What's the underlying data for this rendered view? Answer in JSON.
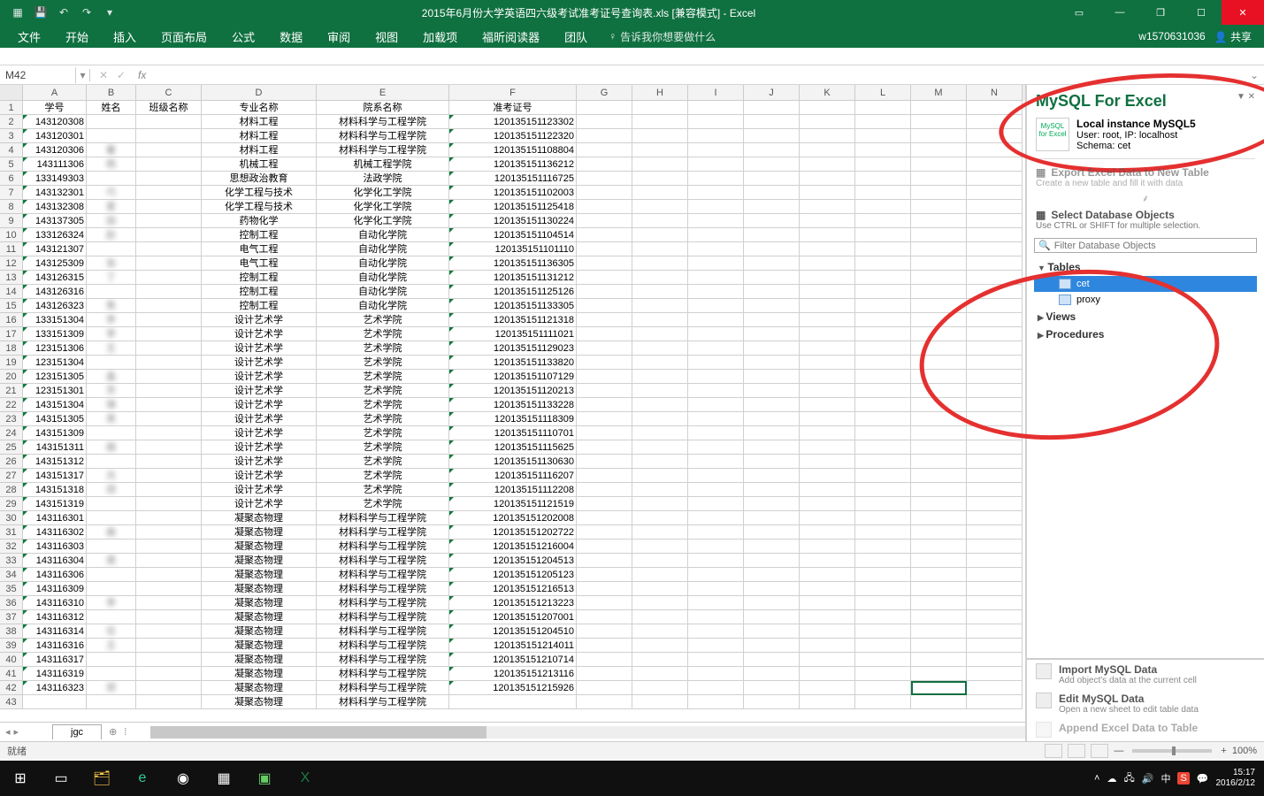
{
  "title": "2015年6月份大学英语四六级考试准考证号查询表.xls [兼容模式] - Excel",
  "qat": {
    "save": "💾",
    "undo": "↶",
    "redo": "↷",
    "more": "▾"
  },
  "ribbon": {
    "tabs": [
      "文件",
      "开始",
      "插入",
      "页面布局",
      "公式",
      "数据",
      "审阅",
      "视图",
      "加载项",
      "福昕阅读器",
      "团队"
    ],
    "tell": "告诉我你想要做什么",
    "user": "w1570631036",
    "share": "共享"
  },
  "namebox": "M42",
  "columns": [
    "A",
    "B",
    "C",
    "D",
    "E",
    "F",
    "G",
    "H",
    "I",
    "J",
    "K",
    "L",
    "M",
    "N"
  ],
  "headers": {
    "A": "学号",
    "B": "姓名",
    "C": "班级名称",
    "D": "专业名称",
    "E": "院系名称",
    "F": "准考证号"
  },
  "rows": [
    {
      "n": 1,
      "A": "学号",
      "B": "姓名",
      "C": "班级名称",
      "D": "专业名称",
      "E": "院系名称",
      "F": "准考证号",
      "hdr": true
    },
    {
      "n": 2,
      "A": "143120308",
      "B": " ",
      "D": "材料工程",
      "E": "材料科学与工程学院",
      "F": "120135151123302"
    },
    {
      "n": 3,
      "A": "143120301",
      "B": " ",
      "D": "材料工程",
      "E": "材料科学与工程学院",
      "F": "120135151122320"
    },
    {
      "n": 4,
      "A": "143120306",
      "B": "暑",
      "D": "材料工程",
      "E": "材料科学与工程学院",
      "F": "120135151108804"
    },
    {
      "n": 5,
      "A": "143111306",
      "B": "杨",
      "D": "机械工程",
      "E": "机械工程学院",
      "F": "120135151136212"
    },
    {
      "n": 6,
      "A": "133149303",
      "B": " ",
      "D": "思想政治教育",
      "E": "法政学院",
      "F": "120135151116725"
    },
    {
      "n": 7,
      "A": "143132301",
      "B": "巧",
      "D": "化学工程与技术",
      "E": "化学化工学院",
      "F": "120135151102003"
    },
    {
      "n": 8,
      "A": "143132308",
      "B": "夏",
      "D": "化学工程与技术",
      "E": "化学化工学院",
      "F": "120135151125418"
    },
    {
      "n": 9,
      "A": "143137305",
      "B": "田",
      "D": "药物化学",
      "E": "化学化工学院",
      "F": "120135151130224"
    },
    {
      "n": 10,
      "A": "133126324",
      "B": "赵",
      "D": "控制工程",
      "E": "自动化学院",
      "F": "120135151104514"
    },
    {
      "n": 11,
      "A": "143121307",
      "B": " ",
      "D": "电气工程",
      "E": "自动化学院",
      "F": "120135151101110"
    },
    {
      "n": 12,
      "A": "143125309",
      "B": "张",
      "D": "电气工程",
      "E": "自动化学院",
      "F": "120135151136305"
    },
    {
      "n": 13,
      "A": "143126315",
      "B": "丁",
      "D": "控制工程",
      "E": "自动化学院",
      "F": "120135151131212"
    },
    {
      "n": 14,
      "A": "143126316",
      "B": " ",
      "D": "控制工程",
      "E": "自动化学院",
      "F": "120135151125126"
    },
    {
      "n": 15,
      "A": "143126323",
      "B": "焦",
      "D": "控制工程",
      "E": "自动化学院",
      "F": "120135151133305"
    },
    {
      "n": 16,
      "A": "133151304",
      "B": "李",
      "D": "设计艺术学",
      "E": "艺术学院",
      "F": "120135151121318"
    },
    {
      "n": 17,
      "A": "133151309",
      "B": "李",
      "D": "设计艺术学",
      "E": "艺术学院",
      "F": "120135151111021"
    },
    {
      "n": 18,
      "A": "123151306",
      "B": "王",
      "D": "设计艺术学",
      "E": "艺术学院",
      "F": "120135151129023"
    },
    {
      "n": 19,
      "A": "123151304",
      "B": " ",
      "D": "设计艺术学",
      "E": "艺术学院",
      "F": "120135151133820"
    },
    {
      "n": 20,
      "A": "123151305",
      "B": "  晶",
      "D": "设计艺术学",
      "E": "艺术学院",
      "F": "120135151107129"
    },
    {
      "n": 21,
      "A": "123151301",
      "B": "  芳",
      "D": "设计艺术学",
      "E": "艺术学院",
      "F": "120135151120213"
    },
    {
      "n": 22,
      "A": "143151304",
      "B": "  弹",
      "D": "设计艺术学",
      "E": "艺术学院",
      "F": "120135151133228"
    },
    {
      "n": 23,
      "A": "143151305",
      "B": "  英",
      "D": "设计艺术学",
      "E": "艺术学院",
      "F": "120135151118309"
    },
    {
      "n": 24,
      "A": "143151309",
      "B": " ",
      "D": "设计艺术学",
      "E": "艺术学院",
      "F": "120135151110701"
    },
    {
      "n": 25,
      "A": "143151311",
      "B": "  娟",
      "D": "设计艺术学",
      "E": "艺术学院",
      "F": "120135151115625"
    },
    {
      "n": 26,
      "A": "143151312",
      "B": " ",
      "D": "设计艺术学",
      "E": "艺术学院",
      "F": "120135151130630"
    },
    {
      "n": 27,
      "A": "143151317",
      "B": "  光",
      "D": "设计艺术学",
      "E": "艺术学院",
      "F": "120135151116207"
    },
    {
      "n": 28,
      "A": "143151318",
      "B": "  颂",
      "D": "设计艺术学",
      "E": "艺术学院",
      "F": "120135151112208"
    },
    {
      "n": 29,
      "A": "143151319",
      "B": " ",
      "D": "设计艺术学",
      "E": "艺术学院",
      "F": "120135151121519"
    },
    {
      "n": 30,
      "A": "143116301",
      "B": " ",
      "D": "凝聚态物理",
      "E": "材料科学与工程学院",
      "F": "120135151202008"
    },
    {
      "n": 31,
      "A": "143116302",
      "B": "曲",
      "D": "凝聚态物理",
      "E": "材料科学与工程学院",
      "F": "120135151202722"
    },
    {
      "n": 32,
      "A": "143116303",
      "B": " ",
      "D": "凝聚态物理",
      "E": "材料科学与工程学院",
      "F": "120135151216004"
    },
    {
      "n": 33,
      "A": "143116304",
      "B": "裘",
      "D": "凝聚态物理",
      "E": "材料科学与工程学院",
      "F": "120135151204513"
    },
    {
      "n": 34,
      "A": "143116306",
      "B": " ",
      "D": "凝聚态物理",
      "E": "材料科学与工程学院",
      "F": "120135151205123"
    },
    {
      "n": 35,
      "A": "143116309",
      "B": " ",
      "D": "凝聚态物理",
      "E": "材料科学与工程学院",
      "F": "120135151216513"
    },
    {
      "n": 36,
      "A": "143116310",
      "B": "李",
      "D": "凝聚态物理",
      "E": "材料科学与工程学院",
      "F": "120135151213223"
    },
    {
      "n": 37,
      "A": "143116312",
      "B": " ",
      "D": "凝聚态物理",
      "E": "材料科学与工程学院",
      "F": "120135151207001"
    },
    {
      "n": 38,
      "A": "143116314",
      "B": "任",
      "D": "凝聚态物理",
      "E": "材料科学与工程学院",
      "F": "120135151204510"
    },
    {
      "n": 39,
      "A": "143116316",
      "B": "王",
      "D": "凝聚态物理",
      "E": "材料科学与工程学院",
      "F": "120135151214011"
    },
    {
      "n": 40,
      "A": "143116317",
      "B": " ",
      "D": "凝聚态物理",
      "E": "材料科学与工程学院",
      "F": "120135151210714"
    },
    {
      "n": 41,
      "A": "143116319",
      "B": " ",
      "D": "凝聚态物理",
      "E": "材料科学与工程学院",
      "F": "120135151213116"
    },
    {
      "n": 42,
      "A": "143116323",
      "B": "郑",
      "D": "凝聚态物理",
      "E": "材料科学与工程学院",
      "F": "120135151215926"
    },
    {
      "n": 43,
      "A": " ",
      "B": " ",
      "D": "凝聚态物理",
      "E": "材料科学与工程学院",
      "F": " "
    }
  ],
  "sheet_tab": "jgc",
  "status": {
    "ready": "就绪",
    "zoom": "100%"
  },
  "mysql": {
    "title": "MySQL For Excel",
    "conn_name": "Local instance MySQL5",
    "conn_user": "User: root, IP: localhost",
    "conn_schema": "Schema: cet",
    "export_t": "Export Excel Data to New Table",
    "export_d": "Create a new table and fill it with data",
    "select_t": "Select Database Objects",
    "select_d": "Use CTRL or SHIFT for multiple selection.",
    "filter_ph": "Filter Database Objects",
    "grp_tables": "Tables",
    "tbl1": "cet",
    "tbl2": "proxy",
    "grp_views": "Views",
    "grp_procs": "Procedures",
    "import_t": "Import MySQL Data",
    "import_d": "Add object's data at the current cell",
    "edit_t": "Edit MySQL Data",
    "edit_d": "Open a new sheet to edit table data",
    "append_t": "Append Excel Data to Table",
    "append_d": " "
  },
  "taskbar": {
    "time": "15:17",
    "date": "2016/2/12"
  }
}
